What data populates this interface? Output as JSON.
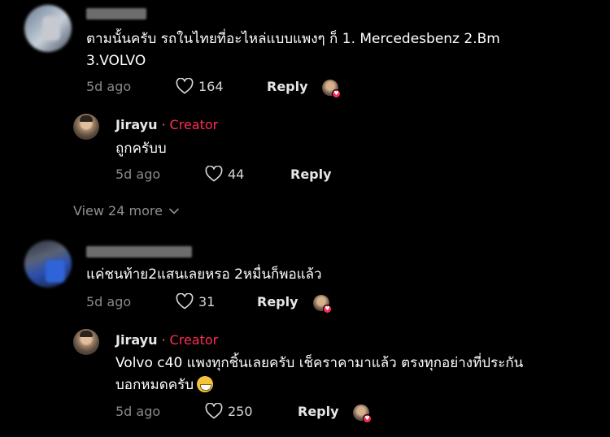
{
  "comments": [
    {
      "text_line1": "ตามนั้นครับ รถในไทยที่อะไหล่แบบแพงๆ ก็ 1. Mercedesbenz 2.Bm",
      "text_line2": "3.VOLVO",
      "time": "5d ago",
      "likes": "164",
      "reply_label": "Reply",
      "reply": {
        "name": "Jirayu",
        "separator": "·",
        "badge": "Creator",
        "text": "ถูกครับบ",
        "time": "5d ago",
        "likes": "44",
        "reply_label": "Reply"
      },
      "view_more": "View 24 more"
    },
    {
      "text_line1": "แค่ชนท้าย2แสนเลยหรอ 2หมื่นก็พอแล้ว",
      "time": "5d ago",
      "likes": "31",
      "reply_label": "Reply",
      "reply": {
        "name": "Jirayu",
        "separator": "·",
        "badge": "Creator",
        "text_line1": "Volvo c40 แพงทุกชิ้นเลยครับ เช็คราคามาแล้ว ตรงทุกอย่างที่ประกัน",
        "text_line2": "บอกหมดครับ",
        "time": "5d ago",
        "likes": "250",
        "reply_label": "Reply"
      }
    }
  ],
  "colors": {
    "background": "#000000",
    "creator_badge": "#fe2c55",
    "muted_text": "#8a8a8a"
  },
  "icons": {
    "like": "heart-outline-icon",
    "expand": "chevron-down-icon",
    "emoji": "grinning-face-emoji-icon",
    "liked_by_creator": "heart-badge-icon"
  }
}
